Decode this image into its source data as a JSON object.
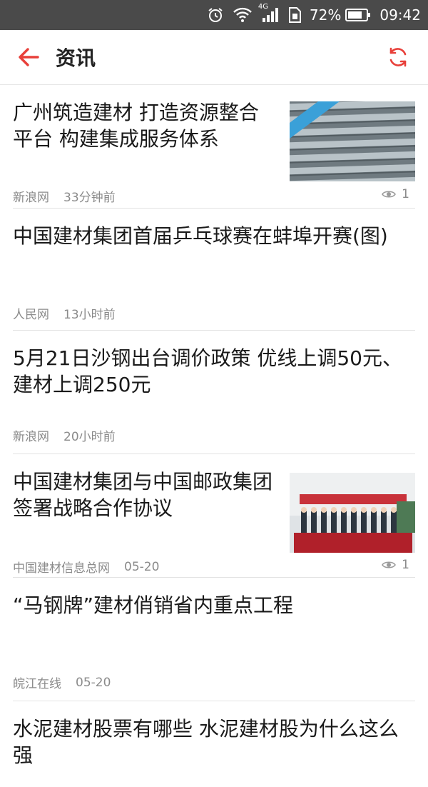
{
  "status_bar": {
    "network": "4G",
    "battery": "72%",
    "time": "09:42"
  },
  "header": {
    "title": "资讯"
  },
  "colors": {
    "accent": "#e8403a",
    "status_bg": "#4a4a4a",
    "meta_text": "#8b8b8b"
  },
  "news": [
    {
      "headline": "广州筑造建材 打造资源整合平台 构建集成服务体系",
      "source": "新浪网",
      "time": "33分钟前",
      "views": "1",
      "thumbnail_icon": "steel-rebar-photo"
    },
    {
      "headline": "中国建材集团首届乒乓球赛在蚌埠开赛(图)",
      "source": "人民网",
      "time": "13小时前"
    },
    {
      "headline": "5月21日沙钢出台调价政策 优线上调50元、建材上调250元",
      "source": "新浪网",
      "time": "20小时前"
    },
    {
      "headline": "中国建材集团与中国邮政集团签署战略合作协议",
      "source": "中国建材信息总网",
      "time": "05-20",
      "views": "1",
      "thumbnail_icon": "signing-ceremony-photo"
    },
    {
      "headline": "“马钢牌”建材俏销省内重点工程",
      "source": "皖江在线",
      "time": "05-20"
    },
    {
      "headline": "水泥建材股票有哪些 水泥建材股为什么这么强"
    }
  ]
}
